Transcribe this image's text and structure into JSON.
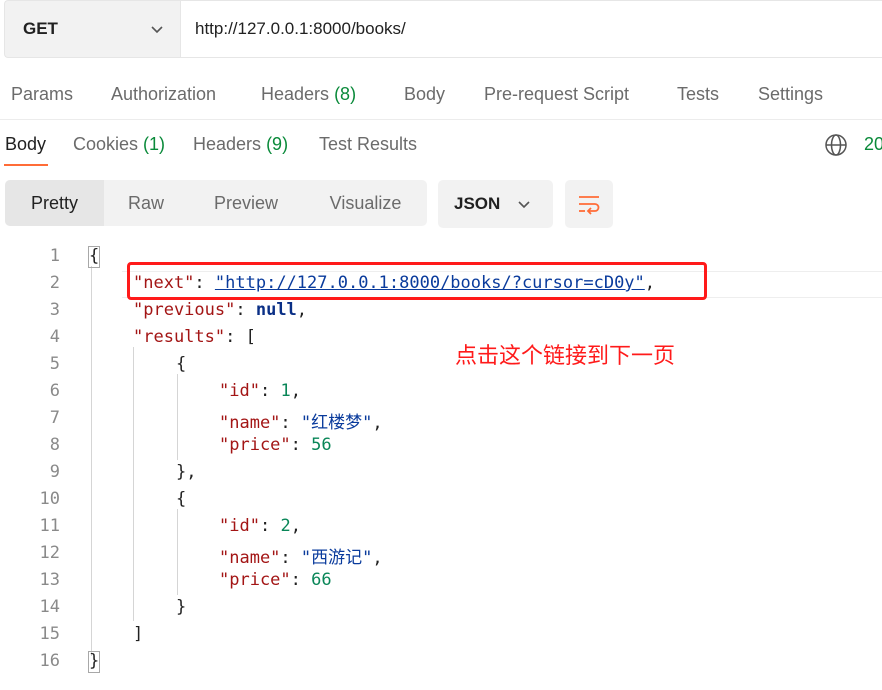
{
  "request": {
    "method": "GET",
    "url": "http://127.0.0.1:8000/books/"
  },
  "request_tabs": [
    {
      "label": "Params"
    },
    {
      "label": "Authorization"
    },
    {
      "label": "Headers",
      "count": "(8)"
    },
    {
      "label": "Body"
    },
    {
      "label": "Pre-request Script"
    },
    {
      "label": "Tests"
    },
    {
      "label": "Settings"
    }
  ],
  "response_tabs": [
    {
      "label": "Body"
    },
    {
      "label": "Cookies",
      "count": "(1)"
    },
    {
      "label": "Headers",
      "count": "(9)"
    },
    {
      "label": "Test Results"
    }
  ],
  "status_partial": "20",
  "view_modes": [
    "Pretty",
    "Raw",
    "Preview",
    "Visualize"
  ],
  "format": "JSON",
  "line_numbers": [
    "1",
    "2",
    "3",
    "4",
    "5",
    "6",
    "7",
    "8",
    "9",
    "10",
    "11",
    "12",
    "13",
    "14",
    "15",
    "16"
  ],
  "json_body": {
    "next_key": "\"next\"",
    "next_value": "\"http://127.0.0.1:8000/books/?cursor=cD0y\"",
    "previous_key": "\"previous\"",
    "previous_value": "null",
    "results_key": "\"results\"",
    "items": [
      {
        "id_key": "\"id\"",
        "id": "1",
        "name_key": "\"name\"",
        "name": "\"红楼梦\"",
        "price_key": "\"price\"",
        "price": "56"
      },
      {
        "id_key": "\"id\"",
        "id": "2",
        "name_key": "\"name\"",
        "name": "\"西游记\"",
        "price_key": "\"price\"",
        "price": "66"
      }
    ]
  },
  "annotation": "点击这个链接到下一页",
  "colors": {
    "accent": "#ff6c37",
    "count_green": "#0a8a3a",
    "annotation_red": "#ff1a1a"
  }
}
